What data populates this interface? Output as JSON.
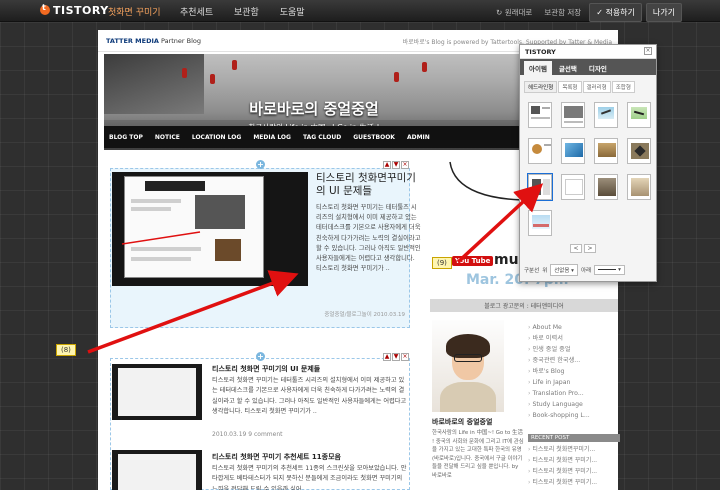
{
  "app": {
    "logo": "TISTORY",
    "editor_name": "첫화면 꾸미기",
    "nav": [
      "추천세트",
      "보관함",
      "도움말"
    ],
    "undo_label": "↻ 원래대로",
    "save_to_storage_label": "보관함 저장",
    "apply_label": "✓ 적용하기",
    "exit_label": "나가기"
  },
  "blog": {
    "tm_logo": "TATTER MEDIA",
    "tm_sub": "Partner Blog",
    "powered_by": "바로바로's Blog is powered by Tattertools. Supported by Tatter & Media",
    "title": "바로바로의 중얼중얼",
    "subtitle": "한국사람의 Life in 中国~! Go in 生活 !",
    "tagline": "BAROO'S BLOG IS POWERED BY TATTERTOOLS. SUPPORTED BY TATTER & MEDIA",
    "nav": [
      "BLOG TOP",
      "NOTICE",
      "LOCATION LOG",
      "MEDIA LOG",
      "TAG CLOUD",
      "GUESTBOOK",
      "ADMIN"
    ]
  },
  "featured": {
    "title": "티스토리 첫화면꾸미기의 UI 문제들",
    "body": "티스토리 첫화면 꾸미기는 테터툴즈 시리즈의 설치형에서 이미 제공하고 있는 테터데스크를 기본으로 사용자에게 더욱 친숙하게 다가가려는 노력의 결실이라고 할 수 있습니다. 그러나 아직도 일반적인 사용자들에게는 어렵다고 생각합니다. 티스토리 첫화면 꾸미기가 ..",
    "meta": "중얼중얼/블로그놀이  2010.03.19"
  },
  "posts": [
    {
      "title": "티스토리 첫화면 꾸미기의 UI 문제들",
      "body": "티스토리 첫화면 꾸미기는 테터툴즈 시리즈의 설치형에서 이미 제공하고 있는 테터데스크를 기본으로 사용자에게 더욱 친숙하게 다가가려는 노력의 결실이라고 할 수 있습니다. 그러나 아직도 일반적인 사용자들에게는 어렵다고 생각합니다. 티스토리 첫화면 꾸미기가 ..",
      "meta": "2010.03.19  9 comment"
    },
    {
      "title": "티스토리 첫화면 꾸미기 추천세트 11종모음",
      "body": "티스토리 첫화면 꾸미기의 추천세트 11종의 스크린샷을 모아보았습니다. 안타깝게도 베타테스터가 되지 못하신 분들에게 조금이라도 첫화면 꾸미기의 느낌을 전달해 드릴 수 있을까 싶어"
    }
  ],
  "sidebar": {
    "music": "mus",
    "youtube": "You Tube",
    "date": "Mar. 20. 7pm",
    "separator": "블로그 광고문의 : 테터앤미디어",
    "profile_name": "바로바로의 중얼중얼",
    "profile_desc": "한국사람의 Life in 中国~! Go to 生活 ! 중국의 사회와 문화에 그리고 IT에 관심을 가지고 있는 고대한 특파 한국의 유영(바로바로)입니다. 중국에서 구글 이야기들을 전달해 드리고 싶을 뿐입니다. by 바로바로",
    "categories": [
      "About Me",
      "바로 이력서",
      "인생 중얼 중얼",
      "중국관련 한국생...",
      "바로's Blog",
      "Life in Japan",
      "Translation Pro...",
      "Study Language",
      "Book-shopping L..."
    ],
    "recent_head": "RECENT POST",
    "recent": [
      "티스토리 첫화면꾸미기...",
      "티스토리 첫화면 꾸미기...",
      "티스토리 첫화면 꾸미기...",
      "티스토리 첫화면 꾸미기..."
    ]
  },
  "panel": {
    "logo": "TISTORY",
    "tabs": [
      "아이템",
      "글선택",
      "디자인"
    ],
    "subtabs": [
      "헤드라인형",
      "목록형",
      "갤러리형",
      "조합형"
    ],
    "pager_prev": "<",
    "pager_next": ">",
    "foot_label": "구분선",
    "foot_pos": "위",
    "foot_pos_sel": "선없음",
    "foot_below": "아래"
  },
  "annotations": {
    "label_8": "(8)",
    "label_9": "(9)"
  },
  "colors": {
    "accent_orange": "#f26a21",
    "annotation_red": "#e01010",
    "dashed_blue": "#9bc7e8"
  }
}
